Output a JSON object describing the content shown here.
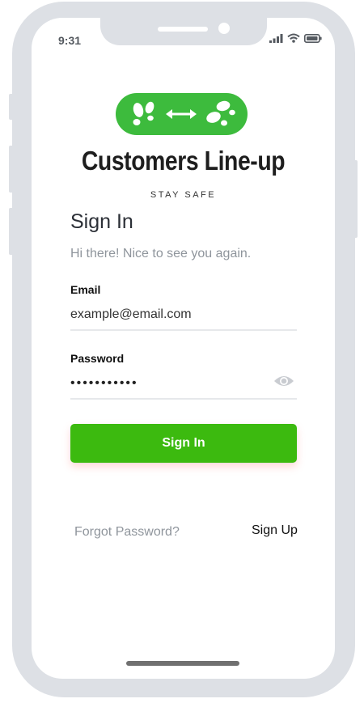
{
  "status_bar": {
    "time": "9:31"
  },
  "app": {
    "title": "Customers Line-up",
    "tagline": "STAY SAFE"
  },
  "signin": {
    "heading": "Sign In",
    "greeting": "Hi there! Nice to see you again.",
    "email_label": "Email",
    "email_value": "example@email.com",
    "password_label": "Password",
    "password_masked": "•••••••••••",
    "submit_label": "Sign In",
    "forgot_label": "Forgot Password?",
    "signup_label": "Sign Up"
  },
  "colors": {
    "brand_green": "#3dbb3d",
    "button_green": "#3cba0f",
    "frame": "#dde0e5"
  },
  "icons": [
    "signal-icon",
    "wifi-icon",
    "battery-icon",
    "footprints-left-icon",
    "double-arrow-icon",
    "footprints-right-icon",
    "eye-icon"
  ]
}
